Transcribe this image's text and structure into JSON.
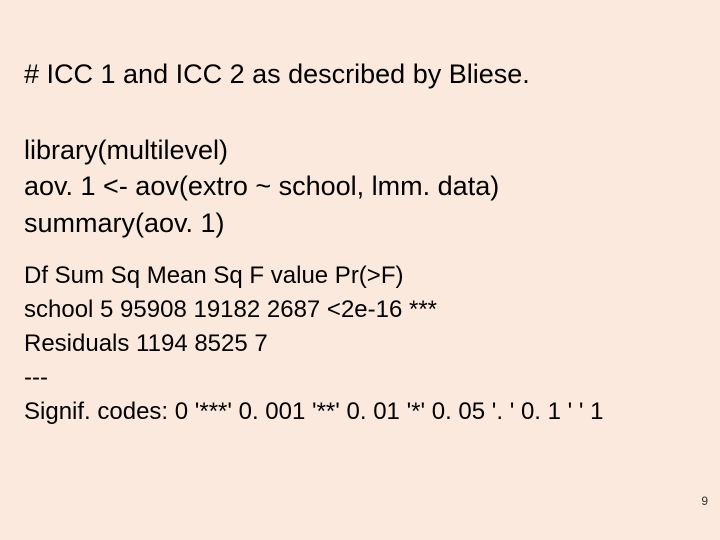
{
  "title": "# ICC 1 and ICC 2 as described by Bliese.",
  "code": {
    "l1": "library(multilevel)",
    "l2": "aov. 1 <- aov(extro ~ school, lmm. data)",
    "l3": "summary(aov. 1)"
  },
  "output": {
    "l1": " Df Sum Sq Mean Sq F value Pr(>F)",
    "l2": "school           5  95908   19182     2687 <2e-16 ***",
    "l3": "Residuals   1194   8525        7",
    "l4": "---",
    "l5": "Signif. codes:  0 '***' 0. 001 '**' 0. 01 '*' 0. 05 '. ' 0. 1 ' ' 1"
  },
  "page": "9"
}
